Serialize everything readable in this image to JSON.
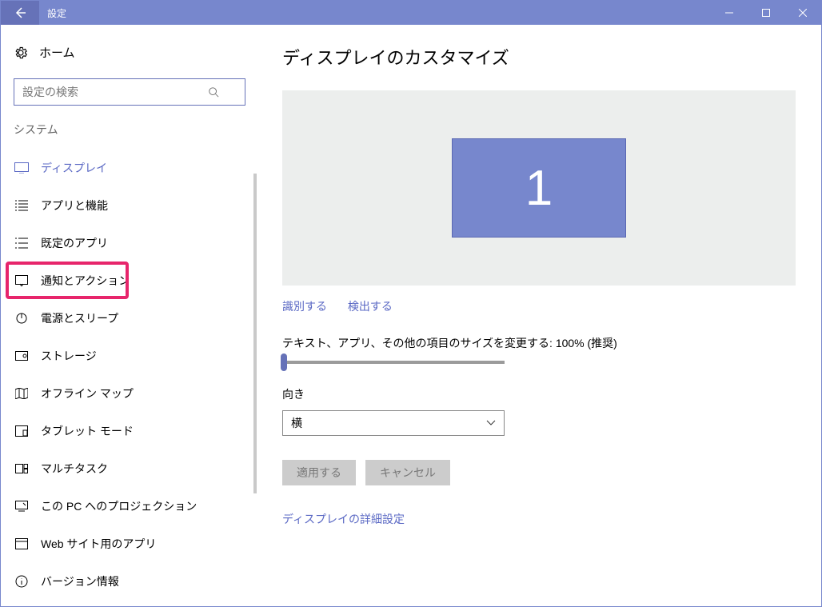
{
  "window": {
    "title": "設定"
  },
  "sidebar": {
    "home_label": "ホーム",
    "search_placeholder": "設定の検索",
    "category_label": "システム",
    "items": [
      {
        "label": "ディスプレイ",
        "selected": true
      },
      {
        "label": "アプリと機能"
      },
      {
        "label": "既定のアプリ"
      },
      {
        "label": "通知とアクション",
        "highlighted": true
      },
      {
        "label": "電源とスリープ"
      },
      {
        "label": "ストレージ"
      },
      {
        "label": "オフライン マップ"
      },
      {
        "label": "タブレット モード"
      },
      {
        "label": "マルチタスク"
      },
      {
        "label": "この PC へのプロジェクション"
      },
      {
        "label": "Web サイト用のアプリ"
      },
      {
        "label": "バージョン情報"
      }
    ]
  },
  "main": {
    "heading": "ディスプレイのカスタマイズ",
    "monitor_number": "1",
    "identify_label": "識別する",
    "detect_label": "検出する",
    "scale_label": "テキスト、アプリ、その他の項目のサイズを変更する: 100% (推奨)",
    "orientation_label": "向き",
    "orientation_value": "横",
    "apply_label": "適用する",
    "cancel_label": "キャンセル",
    "advanced_label": "ディスプレイの詳細設定"
  },
  "colors": {
    "accent": "#7787cd",
    "highlight": "#e7256b"
  }
}
